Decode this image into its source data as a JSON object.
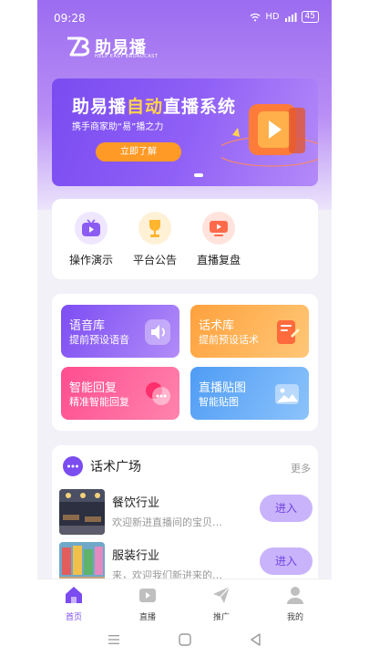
{
  "status_bar": {
    "time": "09:28",
    "network": "HD",
    "signal": "4G",
    "battery": "45"
  },
  "header": {
    "logo_text": "助易播",
    "logo_sub": "HELP EASY BROADCAST"
  },
  "banner": {
    "title_part1": "助易播",
    "title_highlight": "自动",
    "title_part2": "直播系统",
    "subtitle": "携手商家助“易”播之力",
    "button_label": "立即了解"
  },
  "quick_actions": [
    {
      "label": "操作演示",
      "icon": "tv-play-icon"
    },
    {
      "label": "平台公告",
      "icon": "trophy-icon"
    },
    {
      "label": "直播复盘",
      "icon": "screen-play-icon"
    }
  ],
  "tiles": [
    {
      "title": "语音库",
      "subtitle": "提前预设语音",
      "icon": "speaker-icon",
      "color_start": "#7d4df3",
      "color_end": "#b18cf8"
    },
    {
      "title": "话术库",
      "subtitle": "提前预设话术",
      "icon": "script-icon",
      "color_start": "#ffa13d",
      "color_end": "#ffc777"
    },
    {
      "title": "智能回复",
      "subtitle": "精准智能回复",
      "icon": "chat-reply-icon",
      "color_start": "#ff4d8f",
      "color_end": "#ff84ad"
    },
    {
      "title": "直播贴图",
      "subtitle": "智能贴图",
      "icon": "image-icon",
      "color_start": "#4f9cf5",
      "color_end": "#8cc3fb"
    }
  ],
  "script_square": {
    "title": "话术广场",
    "more_label": "更多",
    "items": [
      {
        "name": "餐饮行业",
        "desc": "欢迎新进直播间的宝贝…",
        "button": "进入"
      },
      {
        "name": "服装行业",
        "desc": "来，欢迎我们新进来的…",
        "button": "进入"
      }
    ]
  },
  "tab_bar": [
    {
      "label": "首页",
      "icon": "home-icon",
      "active": true
    },
    {
      "label": "直播",
      "icon": "live-tv-icon",
      "active": false
    },
    {
      "label": "推广",
      "icon": "paper-plane-icon",
      "active": false
    },
    {
      "label": "我的",
      "icon": "user-icon",
      "active": false
    }
  ],
  "colors": {
    "accent": "#7b4cf0",
    "banner_button": "#ff9a26",
    "highlight": "#ffd34d"
  }
}
